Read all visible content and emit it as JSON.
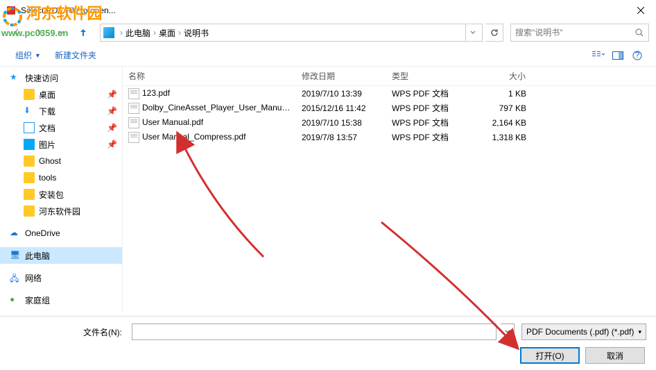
{
  "window": {
    "title": "Select PDF File to open..."
  },
  "breadcrumb": {
    "root": "此电脑",
    "p1": "桌面",
    "p2": "说明书"
  },
  "search": {
    "placeholder": "搜索\"说明书\""
  },
  "toolbar": {
    "organize": "组织",
    "newfolder": "新建文件夹"
  },
  "sidebar": {
    "quick": "快速访问",
    "desktop": "桌面",
    "download": "下载",
    "docs": "文档",
    "pics": "图片",
    "ghost": "Ghost",
    "tools": "tools",
    "install": "安装包",
    "hdy": "河东软件园",
    "onedrive": "OneDrive",
    "thispc": "此电脑",
    "network": "网络",
    "homegroup": "家庭组"
  },
  "columns": {
    "name": "名称",
    "date": "修改日期",
    "type": "类型",
    "size": "大小"
  },
  "files": [
    {
      "name": "123.pdf",
      "date": "2019/7/10 13:39",
      "type": "WPS PDF 文档",
      "size": "1 KB"
    },
    {
      "name": "Dolby_CineAsset_Player_User_Manual...",
      "date": "2015/12/16 11:42",
      "type": "WPS PDF 文档",
      "size": "797 KB"
    },
    {
      "name": "User Manual.pdf",
      "date": "2019/7/10 15:38",
      "type": "WPS PDF 文档",
      "size": "2,164 KB"
    },
    {
      "name": "User Manual_Compress.pdf",
      "date": "2019/7/8 13:57",
      "type": "WPS PDF 文档",
      "size": "1,318 KB"
    }
  ],
  "footer": {
    "filename_label": "文件名(N):",
    "filename_value": "",
    "filter": "PDF Documents (.pdf) (*.pdf)",
    "open": "打开(O)",
    "cancel": "取消"
  },
  "watermark": {
    "text": "河东软件园",
    "url": "www.pc0359.cn"
  }
}
